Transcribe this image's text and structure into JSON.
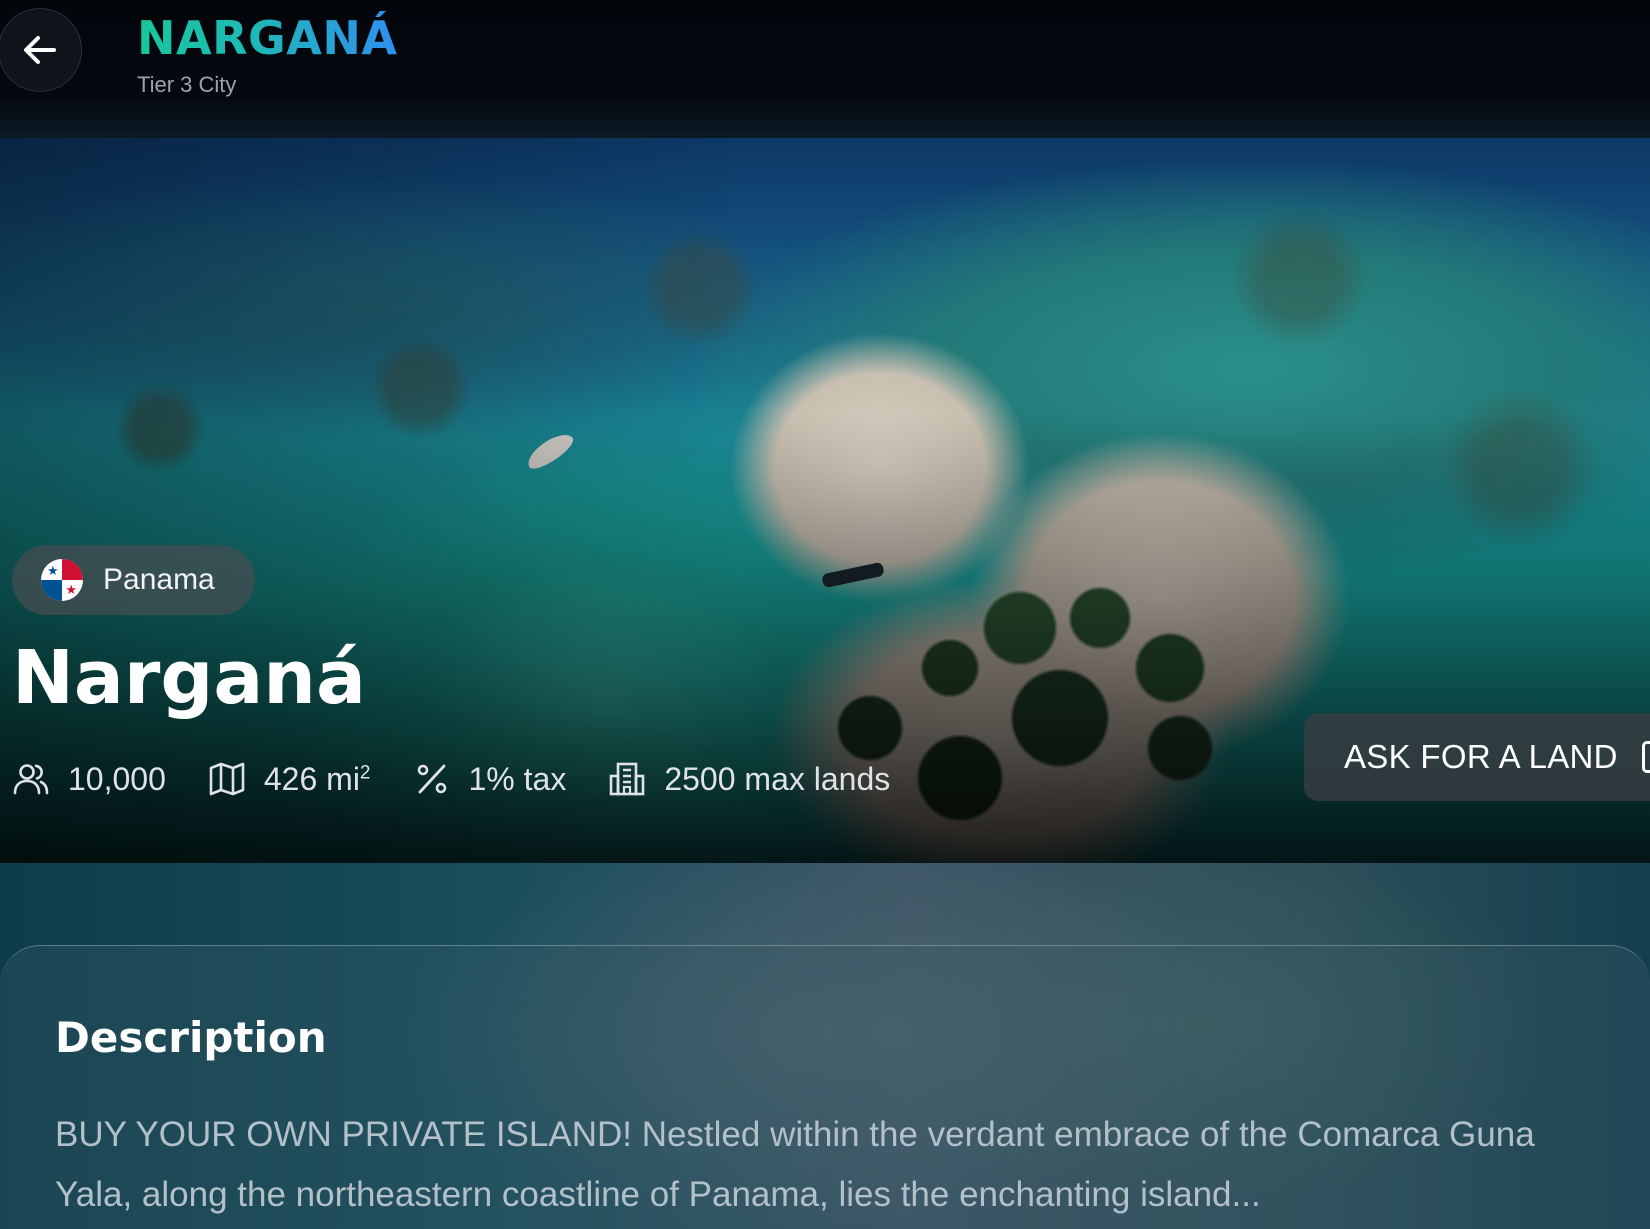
{
  "header": {
    "title": "NARGANÁ",
    "subtitle": "Tier 3 City",
    "back_icon": "arrow-left-icon"
  },
  "hero": {
    "country": "Panama",
    "country_flag": "panama-flag-icon",
    "name": "Narganá",
    "stats": {
      "population": "10,000",
      "area": "426 mi",
      "area_exponent": "2",
      "tax": "1% tax",
      "max_lands": "2500 max lands"
    },
    "ask_button": "ASK FOR A LAND"
  },
  "description": {
    "title": "Description",
    "text": "BUY YOUR OWN PRIVATE ISLAND! Nestled within the verdant embrace of the Comarca Guna Yala, along the northeastern coastline of Panama, lies the enchanting island..."
  },
  "colors": {
    "title_gradient_start": "#18c79c",
    "title_gradient_end": "#2f8ff0",
    "panama_red": "#d21034",
    "panama_blue": "#005293"
  }
}
